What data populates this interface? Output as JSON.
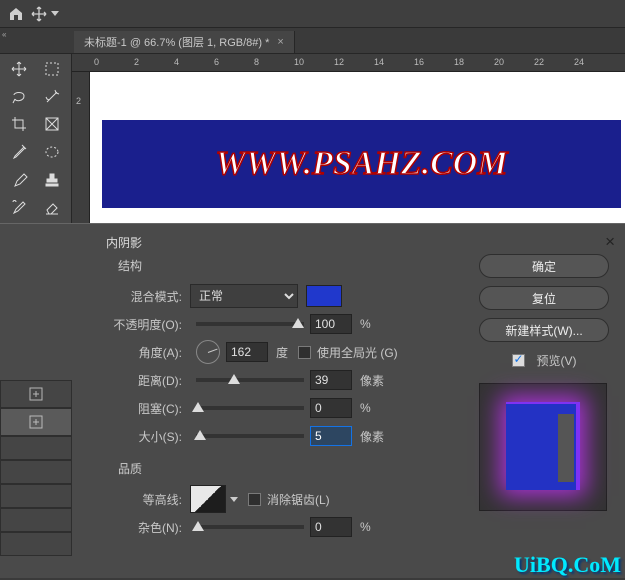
{
  "topbar": {
    "home": "home-icon",
    "move": "move-icon"
  },
  "tab": {
    "title": "未标题-1 @ 66.7% (图层 1, RGB/8#) *",
    "close": "×"
  },
  "ruler_h": [
    "0",
    "2",
    "4",
    "6",
    "8",
    "10",
    "12",
    "14",
    "16",
    "18",
    "20",
    "22",
    "24"
  ],
  "ruler_v": [
    "2"
  ],
  "canvas": {
    "text": "WWW.PSAHZ.COM"
  },
  "fx": {
    "title": "内阴影",
    "group_structure": "结构",
    "blend_mode_label": "混合模式:",
    "blend_mode_value": "正常",
    "color": "#2038cc",
    "opacity_label": "不透明度(O):",
    "opacity_value": "100",
    "opacity_unit": "%",
    "angle_label": "角度(A):",
    "angle_value": "162",
    "angle_unit": "度",
    "global_light": "使用全局光 (G)",
    "distance_label": "距离(D):",
    "distance_value": "39",
    "distance_unit": "像素",
    "choke_label": "阻塞(C):",
    "choke_value": "0",
    "choke_unit": "%",
    "size_label": "大小(S):",
    "size_value": "5",
    "size_unit": "像素",
    "group_quality": "品质",
    "contour_label": "等高线:",
    "antialias": "消除锯齿(L)",
    "noise_label": "杂色(N):",
    "noise_value": "0",
    "noise_unit": "%"
  },
  "buttons": {
    "ok": "确定",
    "reset": "复位",
    "new_style": "新建样式(W)...",
    "preview": "预览(V)"
  },
  "watermark": "UiBQ.CoM"
}
